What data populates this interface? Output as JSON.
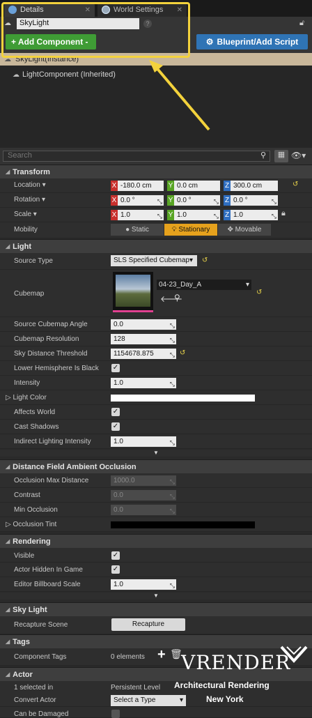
{
  "tabs": {
    "details": "Details",
    "world": "World Settings"
  },
  "name_field": "SkyLight",
  "buttons": {
    "add": "+ Add Component -",
    "blueprint": "Blueprint/Add Script"
  },
  "tree": {
    "selected": "SkyLight(Instance)",
    "child": "LightComponent (Inherited)"
  },
  "search": {
    "placeholder": "Search"
  },
  "transform": {
    "title": "Transform",
    "location": {
      "label": "Location",
      "x": "-180.0 cm",
      "y": "0.0 cm",
      "z": "300.0 cm"
    },
    "rotation": {
      "label": "Rotation",
      "x": "0.0 °",
      "y": "0.0 °",
      "z": "0.0 °"
    },
    "scale": {
      "label": "Scale",
      "x": "1.0",
      "y": "1.0",
      "z": "1.0"
    },
    "mobility": {
      "label": "Mobility",
      "static": "Static",
      "stationary": "Stationary",
      "movable": "Movable"
    }
  },
  "light": {
    "title": "Light",
    "source_type": {
      "label": "Source Type",
      "value": "SLS Specified Cubemap"
    },
    "cubemap": {
      "label": "Cubemap",
      "value": "04-23_Day_A"
    },
    "source_angle": {
      "label": "Source Cubemap Angle",
      "value": "0.0"
    },
    "resolution": {
      "label": "Cubemap Resolution",
      "value": "128"
    },
    "threshold": {
      "label": "Sky Distance Threshold",
      "value": "1154678.875"
    },
    "lower_hemi": {
      "label": "Lower Hemisphere Is Black"
    },
    "intensity": {
      "label": "Intensity",
      "value": "1.0"
    },
    "light_color": {
      "label": "Light Color",
      "color": "#ffffff"
    },
    "affects_world": {
      "label": "Affects World"
    },
    "cast_shadows": {
      "label": "Cast Shadows"
    },
    "indirect": {
      "label": "Indirect Lighting Intensity",
      "value": "1.0"
    }
  },
  "dfao": {
    "title": "Distance Field Ambient Occlusion",
    "max_dist": {
      "label": "Occlusion Max Distance",
      "value": "1000.0"
    },
    "contrast": {
      "label": "Contrast",
      "value": "0.0"
    },
    "min_occ": {
      "label": "Min Occlusion",
      "value": "0.0"
    },
    "tint": {
      "label": "Occlusion Tint",
      "color": "#000000"
    }
  },
  "rendering": {
    "title": "Rendering",
    "visible": {
      "label": "Visible"
    },
    "hidden": {
      "label": "Actor Hidden In Game"
    },
    "billboard": {
      "label": "Editor Billboard Scale",
      "value": "1.0"
    }
  },
  "skylight": {
    "title": "Sky Light",
    "recapture": {
      "label": "Recapture Scene",
      "button": "Recapture"
    }
  },
  "tags": {
    "title": "Tags",
    "component_tags": {
      "label": "Component Tags",
      "value": "0 elements"
    }
  },
  "actor": {
    "title": "Actor",
    "selected": {
      "label": "1 selected in",
      "value": "Persistent Level"
    },
    "convert": {
      "label": "Convert Actor",
      "value": "Select a Type"
    },
    "damaged": {
      "label": "Can be Damaged"
    }
  },
  "watermark": {
    "brand": "VRENDER",
    "line1": "Architectural Rendering",
    "line2": "New York"
  },
  "colors": {
    "highlight": "#f3d23c",
    "arrow_yellow": "#f3d23c",
    "arrow_red": "#e0423a",
    "add_green": "#3f9c35",
    "bp_blue": "#2f74b5",
    "stationary": "#e6a21d"
  }
}
